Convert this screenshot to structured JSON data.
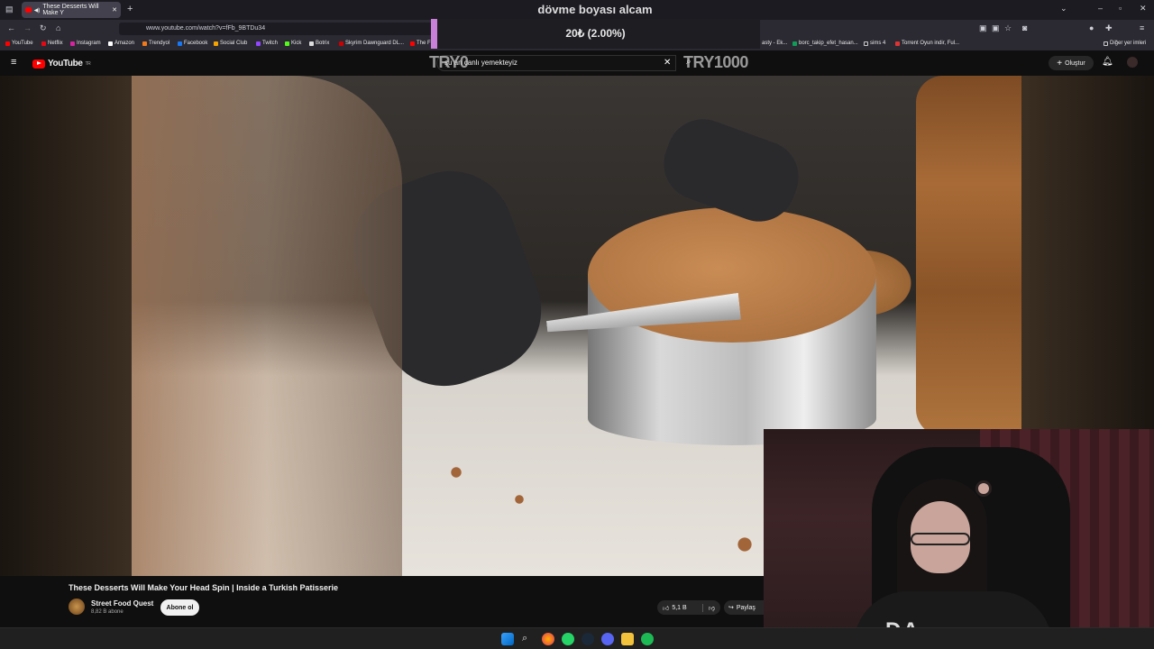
{
  "browser": {
    "tab_title": "These Desserts Will Make Y",
    "url": "www.youtube.com/watch?v=fFb_9BTDu34",
    "bookmarks": [
      "YouTube",
      "Netflix",
      "Instagram",
      "Amazon",
      "Trendyol",
      "Facebook",
      "Social Club",
      "Twitch",
      "Kick",
      "Botrix",
      "Skyrim Dawnguard DL...",
      "The F",
      "asty - Ek...",
      "borc_takip_efet_hasan...",
      "sims 4",
      "Torrent Oyun indir, Ful...",
      "Diğer yer imleri"
    ],
    "colors": {
      "tab_bg": "#42414d",
      "toolbar_bg": "#2b2a33"
    }
  },
  "youtube": {
    "logo_text": "YouTube",
    "logo_region": "TR",
    "search_value": "şu an canlı yemekteyiz",
    "create_label": "Oluştur",
    "video_title": "These Desserts Will Make Your Head Spin | Inside a Turkish Patisserie",
    "channel_name": "Street Food Quest",
    "subscribers": "8,82 B abone",
    "subscribe_label": "Abone ol",
    "likes": "5,1 B",
    "share_label": "Paylaş",
    "accent": "#ff0000"
  },
  "overlay": {
    "donation_title": "dövme boyası alcam",
    "donation_amount": "20₺ (2.00%)",
    "goal_left": "TRY0",
    "goal_right": "TRY1000",
    "progress_percent": 2.0,
    "bar_color": "#c980d9"
  },
  "webcam": {
    "hoodie_text": "DA"
  }
}
